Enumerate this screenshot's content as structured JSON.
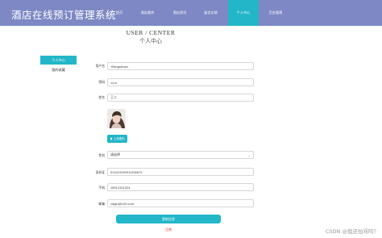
{
  "header": {
    "site_title": "酒店在线预订管理系统",
    "nav": [
      "首页",
      "酒店客房",
      "酒店资讯",
      "留言反馈",
      "个人中心",
      "后台管理"
    ]
  },
  "page": {
    "title_en": "USER / CENTER",
    "title_cn": "个人中心"
  },
  "sidebar": {
    "items": [
      {
        "label": "个人中心",
        "active": true
      },
      {
        "label": "我的收藏",
        "active": false
      }
    ]
  },
  "form": {
    "username": {
      "label": "用户名",
      "value": "Yilangshuan"
    },
    "password": {
      "label": "密码",
      "value": "••••••"
    },
    "name": {
      "label": "姓名",
      "value": "王二"
    },
    "upload_label": "上传图片",
    "gender": {
      "label": "性别",
      "value": "请选择"
    },
    "id_card": {
      "label": "身份证",
      "value": "511523199911256679"
    },
    "phone": {
      "label": "手机",
      "value": "18912341324"
    },
    "email": {
      "label": "邮箱",
      "value": "xiagh@163.com"
    },
    "save_label": "更新信息",
    "logout_label": "注销"
  },
  "watermark": "CSDN @我还怕骂吗？",
  "colors": {
    "header": "#7d88c4",
    "accent": "#22b6c8",
    "logout": "#e53935"
  }
}
